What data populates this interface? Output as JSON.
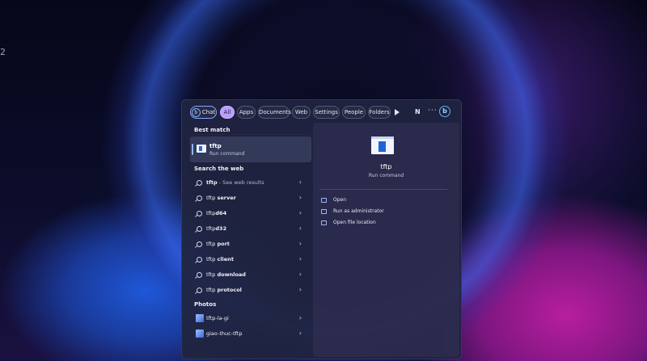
{
  "desktop": {
    "edge_mark": "2"
  },
  "search": {
    "tabs": [
      {
        "label": "Chat"
      },
      {
        "label": "All"
      },
      {
        "label": "Apps"
      },
      {
        "label": "Documents"
      },
      {
        "label": "Web"
      },
      {
        "label": "Settings"
      },
      {
        "label": "People"
      },
      {
        "label": "Folders"
      }
    ],
    "user_initial": "N",
    "more_label": "···",
    "bing_label": "b"
  },
  "results": {
    "best_match_title": "Best match",
    "best_match": {
      "name": "tftp",
      "type": "Run command"
    },
    "web_title": "Search the web",
    "web_items": [
      {
        "term": "tftp",
        "suffix": " - See web results"
      },
      {
        "term": "tftp ",
        "bold": "server"
      },
      {
        "term": "tftp",
        "bold": "d64"
      },
      {
        "term": "tftp",
        "bold": "d32"
      },
      {
        "term": "tftp ",
        "bold": "port"
      },
      {
        "term": "tftp ",
        "bold": "client"
      },
      {
        "term": "tftp ",
        "bold": "download"
      },
      {
        "term": "tftp ",
        "bold": "protocol"
      }
    ],
    "photos_title": "Photos",
    "photos": [
      {
        "name": "tftp-la-gi"
      },
      {
        "name": "giao-thuc-tftp"
      }
    ]
  },
  "preview": {
    "title": "tftp",
    "subtitle": "Run command",
    "actions": [
      {
        "label": "Open"
      },
      {
        "label": "Run as administrator"
      },
      {
        "label": "Open file location"
      }
    ]
  },
  "chevron": "›"
}
